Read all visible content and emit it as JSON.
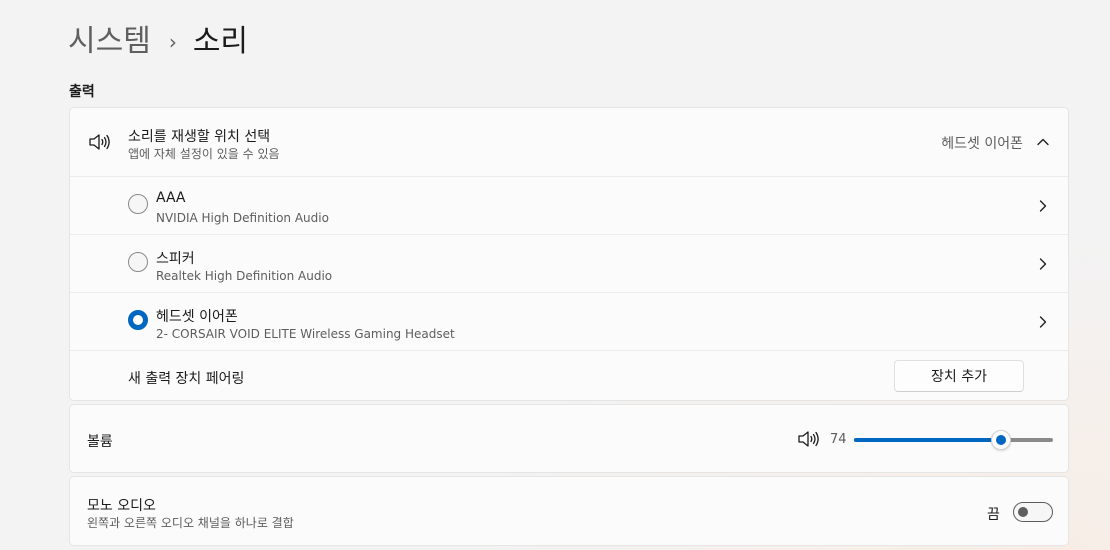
{
  "breadcrumb": {
    "parent": "시스템",
    "separator": "›",
    "current": "소리"
  },
  "output": {
    "section_label": "출력",
    "selector": {
      "title": "소리를 재생할 위치 선택",
      "subtitle": "앱에 자체 설정이 있을 수 있음",
      "current_value": "헤드셋 이어폰",
      "expanded": true,
      "icon": "speaker-icon"
    },
    "devices": [
      {
        "name": "AAA",
        "description": "NVIDIA High Definition Audio",
        "selected": false
      },
      {
        "name": "스피커",
        "description": "Realtek High Definition Audio",
        "selected": false
      },
      {
        "name": "헤드셋 이어폰",
        "description": "2- CORSAIR VOID ELITE Wireless Gaming Headset",
        "selected": true
      }
    ],
    "pair": {
      "label": "새 출력 장치 페어링",
      "button_label": "장치 추가"
    }
  },
  "volume": {
    "label": "볼륨",
    "value": "74",
    "level": 74,
    "icon": "speaker-icon"
  },
  "mono": {
    "title": "모노 오디오",
    "subtitle": "왼쪽과 오른쪽 오디오 채널을 하나로 결합",
    "state_label": "끔",
    "enabled": false
  },
  "colors": {
    "accent": "#0067c0",
    "background": "#f3f3f3",
    "card": "#fbfbfb"
  }
}
